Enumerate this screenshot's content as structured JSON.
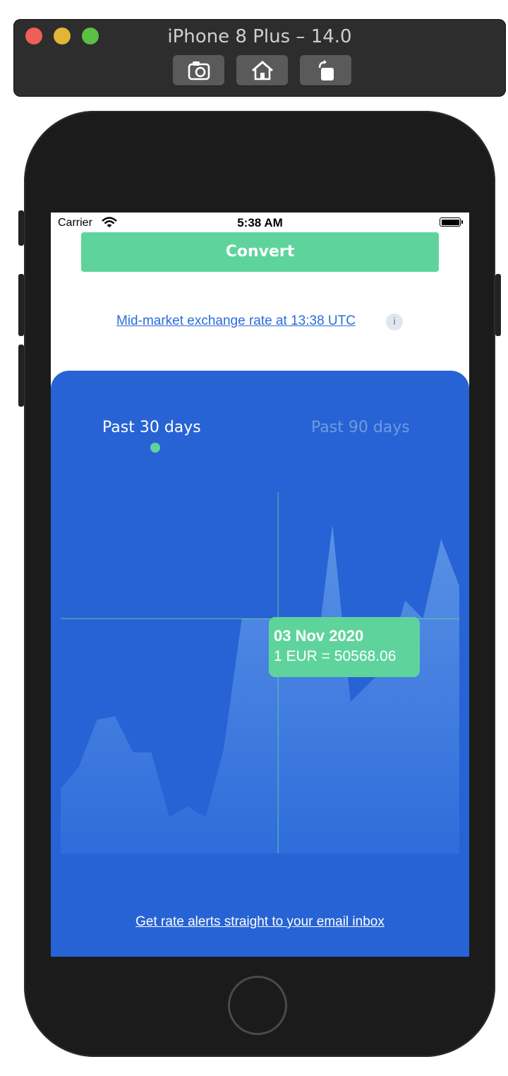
{
  "window": {
    "title": "iPhone 8 Plus – 14.0",
    "buttons": [
      {
        "name": "screenshot",
        "icon": "camera-icon"
      },
      {
        "name": "home",
        "icon": "home-icon"
      },
      {
        "name": "rotate",
        "icon": "rotate-icon"
      }
    ]
  },
  "status_bar": {
    "carrier": "Carrier",
    "time": "5:38 AM"
  },
  "convert": {
    "label": "Convert"
  },
  "rate_link": {
    "text": "Mid-market exchange rate at 13:38 UTC",
    "info": "i"
  },
  "tabs": [
    {
      "label": "Past 30 days",
      "selected": true
    },
    {
      "label": "Past 90 days",
      "selected": false
    }
  ],
  "tooltip": {
    "date": "03 Nov 2020",
    "rate": "1 EUR = 50568.06"
  },
  "footer_link": "Get rate alerts straight to your email inbox",
  "chart_data": {
    "type": "area",
    "title": "",
    "xlabel": "",
    "ylabel": "",
    "grid": false,
    "legend": "none",
    "series": [
      {
        "values": [
          0.18,
          0.24,
          0.37,
          0.38,
          0.28,
          0.28,
          0.1,
          0.13,
          0.1,
          0.29,
          0.65,
          0.65,
          0.65,
          0.54,
          0.5,
          0.91,
          0.42,
          0.47,
          0.52,
          0.7,
          0.65,
          0.87,
          0.74
        ]
      }
    ],
    "highlighted_index": 12,
    "colors": {
      "fill": "#5a93e8",
      "crosshair": "#5ed49c"
    }
  },
  "colors": {
    "accent": "#5ed49c",
    "panel": "#2763d4",
    "link": "#2a6ddb"
  }
}
